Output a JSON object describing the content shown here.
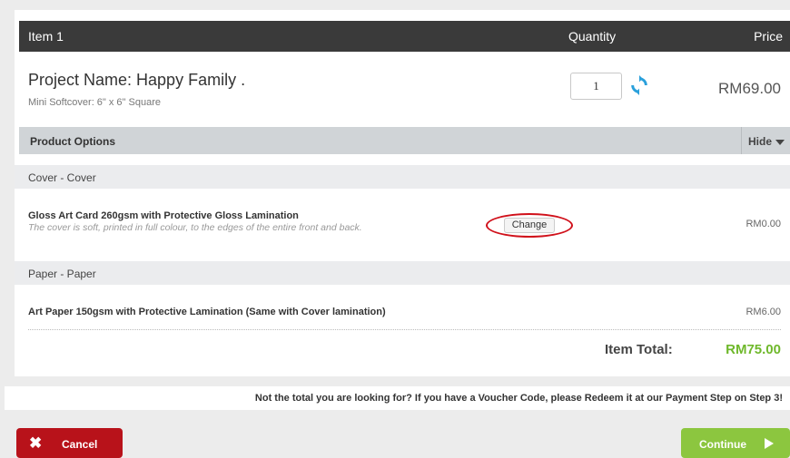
{
  "header": {
    "item": "Item 1",
    "quantity": "Quantity",
    "price": "Price"
  },
  "project": {
    "name": "Project Name: Happy Family .",
    "subtitle": "Mini Softcover: 6\" x 6\" Square",
    "quantity_value": "1",
    "price": "RM69.00"
  },
  "product_options": {
    "label": "Product Options",
    "hide_label": "Hide",
    "sections": [
      {
        "title": "Cover - Cover",
        "option_name": "Gloss Art Card 260gsm with Protective Gloss Lamination",
        "option_desc": "The cover is soft, printed in full colour, to the edges of the entire front and back.",
        "button_label": "Change",
        "price": "RM0.00"
      },
      {
        "title": "Paper - Paper",
        "option_name": "Art Paper 150gsm with Protective Lamination (Same with Cover lamination)",
        "price": "RM6.00"
      }
    ]
  },
  "total": {
    "label": "Item Total:",
    "value": "RM75.00"
  },
  "notice": "Not the total you are looking for? If you have a Voucher Code, please Redeem it at our Payment Step on Step 3!",
  "footer": {
    "cancel_label": "Cancel",
    "continue_label": "Continue"
  },
  "colors": {
    "header_bg": "#3a3a3a",
    "total_green": "#6fb82b",
    "cancel_red": "#b8121a",
    "continue_green": "#8cc63f",
    "highlight_ring": "#d0101a"
  },
  "icons": {
    "refresh": "refresh-icon",
    "hide": "caret-down-icon",
    "cancel": "close-icon",
    "continue": "play-arrow-icon"
  }
}
